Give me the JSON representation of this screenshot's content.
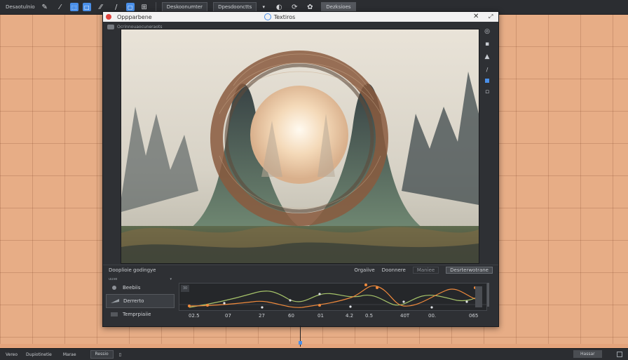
{
  "toolbar": {
    "title": "Desaotulnio",
    "tools": [
      {
        "icon": "pen-icon",
        "glyph": "✎"
      },
      {
        "icon": "brush-icon",
        "glyph": "⁄"
      },
      {
        "icon": "slash-icon",
        "glyph": "/"
      },
      {
        "icon": "line-icon",
        "glyph": "⁄⁄"
      },
      {
        "icon": "rect-icon",
        "glyph": "□"
      }
    ],
    "field1": "Deskoonumter",
    "field2": "Dpesdoonctts",
    "field3": "Dezksioes",
    "icons2": [
      "settings-icon",
      "cursor-icon"
    ]
  },
  "window": {
    "title": "Oppparbene",
    "tab_label": "Textiros",
    "subheader": "Ocrinnouaocuneraots",
    "status_left": "Dooplioie godingye",
    "tabs": [
      "Orgaiive",
      "Doonnere",
      "Maniee",
      "Desrterwotrane"
    ]
  },
  "left_panel": {
    "head": "uuve",
    "items": [
      "Beebiis",
      "Derrerto",
      "Temprpiaiie"
    ]
  },
  "curve_panel": {
    "chip": "30",
    "ticks": [
      "02.5",
      "07",
      "27",
      "60",
      "01",
      "4.2",
      "0.5",
      "40T",
      "00.",
      "065"
    ]
  },
  "bottombar": {
    "items": [
      "Vereo",
      "Dupiotinetie",
      "Marae"
    ],
    "box": "Ressio",
    "right": "Hassar"
  },
  "colors": {
    "accent": "#4a8fe8",
    "curve_green": "#a6c36a",
    "curve_orange": "#f08a3c",
    "background": "#e7ad86"
  }
}
